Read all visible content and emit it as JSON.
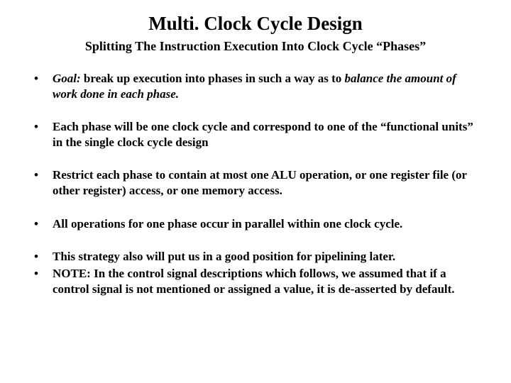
{
  "title": "Multi. Clock Cycle Design",
  "subtitle": "Splitting The Instruction Execution Into Clock Cycle “Phases”",
  "bullets": {
    "b1_a": "Goal:",
    "b1_b": " break up execution into phases in such a way as to  ",
    "b1_c": "balance the amount of work done in each phase.",
    "b2": "Each phase will be one clock cycle and correspond to one of the “functional units” in the single clock cycle design",
    "b3": "Restrict each phase to contain at most one ALU operation, or one register file (or other register)  access, or one memory access.",
    "b4": "All operations for one phase occur in parallel within one clock cycle.",
    "b5": "This strategy also will put us in a good position for pipelining later.",
    "b6": "NOTE: In the control signal descriptions which follows, we assumed that if a control signal is not mentioned or assigned a value, it is de-asserted by default."
  }
}
